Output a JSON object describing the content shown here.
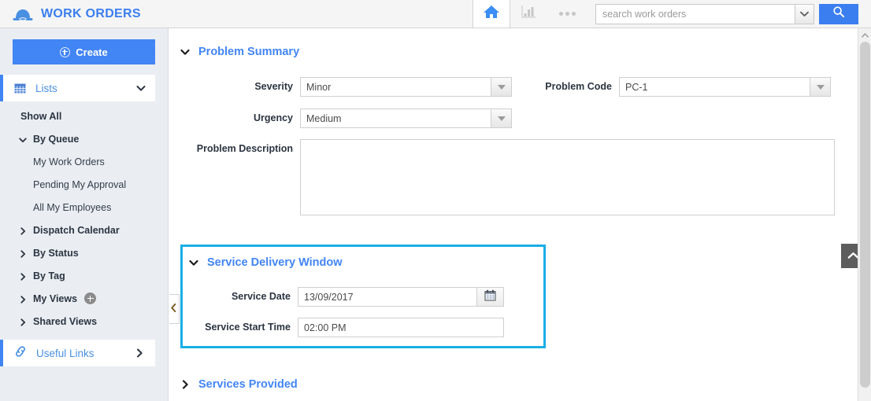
{
  "header": {
    "brand_title": "WORK ORDERS",
    "logo_icon": "hardhat-icon",
    "home_icon": "home-icon",
    "chart_icon": "bar-chart-icon",
    "more_icon": "more-dots-icon",
    "search_placeholder": "search work orders",
    "search_value": "",
    "search_dropdown_icon": "chevron-down-icon",
    "search_button_icon": "search-icon"
  },
  "sidebar": {
    "create_label": "Create",
    "create_icon": "plus-circle-icon",
    "lists": {
      "label": "Lists",
      "icon": "grid-icon",
      "chevron": "chevron-down-icon"
    },
    "items": [
      {
        "label": "Show All",
        "level": 1,
        "bold": true,
        "chevron": null
      },
      {
        "label": "By Queue",
        "level": 1,
        "bold": true,
        "chevron": "chevron-down-icon"
      },
      {
        "label": "My Work Orders",
        "level": 2,
        "bold": false,
        "chevron": null
      },
      {
        "label": "Pending My Approval",
        "level": 2,
        "bold": false,
        "chevron": null
      },
      {
        "label": "All My Employees",
        "level": 2,
        "bold": false,
        "chevron": null
      },
      {
        "label": "Dispatch Calendar",
        "level": 1,
        "bold": true,
        "chevron": "chevron-right-icon"
      },
      {
        "label": "By Status",
        "level": 1,
        "bold": true,
        "chevron": "chevron-right-icon"
      },
      {
        "label": "By Tag",
        "level": 1,
        "bold": true,
        "chevron": "chevron-right-icon"
      },
      {
        "label": "My Views",
        "level": 1,
        "bold": true,
        "chevron": "chevron-right-icon",
        "badge": "plus-badge-icon"
      },
      {
        "label": "Shared Views",
        "level": 1,
        "bold": true,
        "chevron": "chevron-right-icon"
      }
    ],
    "useful_links": {
      "label": "Useful Links",
      "icon": "link-icon",
      "chevron": "chevron-right-icon"
    }
  },
  "content": {
    "collapse_handle_icon": "chevron-left-icon",
    "scroll_top_icon": "chevron-up-icon",
    "sections": {
      "problem_summary": {
        "title": "Problem Summary",
        "chevron": "chevron-down-icon",
        "fields": {
          "severity": {
            "label": "Severity",
            "value": "Minor",
            "dropdown_icon": "caret-down-icon"
          },
          "urgency": {
            "label": "Urgency",
            "value": "Medium",
            "dropdown_icon": "caret-down-icon"
          },
          "problem_code": {
            "label": "Problem Code",
            "value": "PC-1",
            "dropdown_icon": "caret-down-icon"
          },
          "problem_description": {
            "label": "Problem Description",
            "value": "",
            "placeholder": ""
          }
        }
      },
      "service_delivery_window": {
        "title": "Service Delivery Window",
        "chevron": "chevron-down-icon",
        "highlighted": true,
        "highlight_color": "#1aaee5",
        "fields": {
          "service_date": {
            "label": "Service Date",
            "value": "13/09/2017",
            "button_icon": "calendar-icon"
          },
          "service_start_time": {
            "label": "Service Start Time",
            "value": "02:00 PM"
          }
        }
      },
      "services_provided": {
        "title": "Services Provided",
        "chevron": "chevron-right-icon"
      }
    }
  },
  "colors": {
    "brand_blue": "#3b7ef0",
    "accent_blue": "#4285f4",
    "highlight_cyan": "#1aaee5",
    "sidebar_bg": "#eaeef3",
    "header_bg": "#f5f5f5"
  }
}
